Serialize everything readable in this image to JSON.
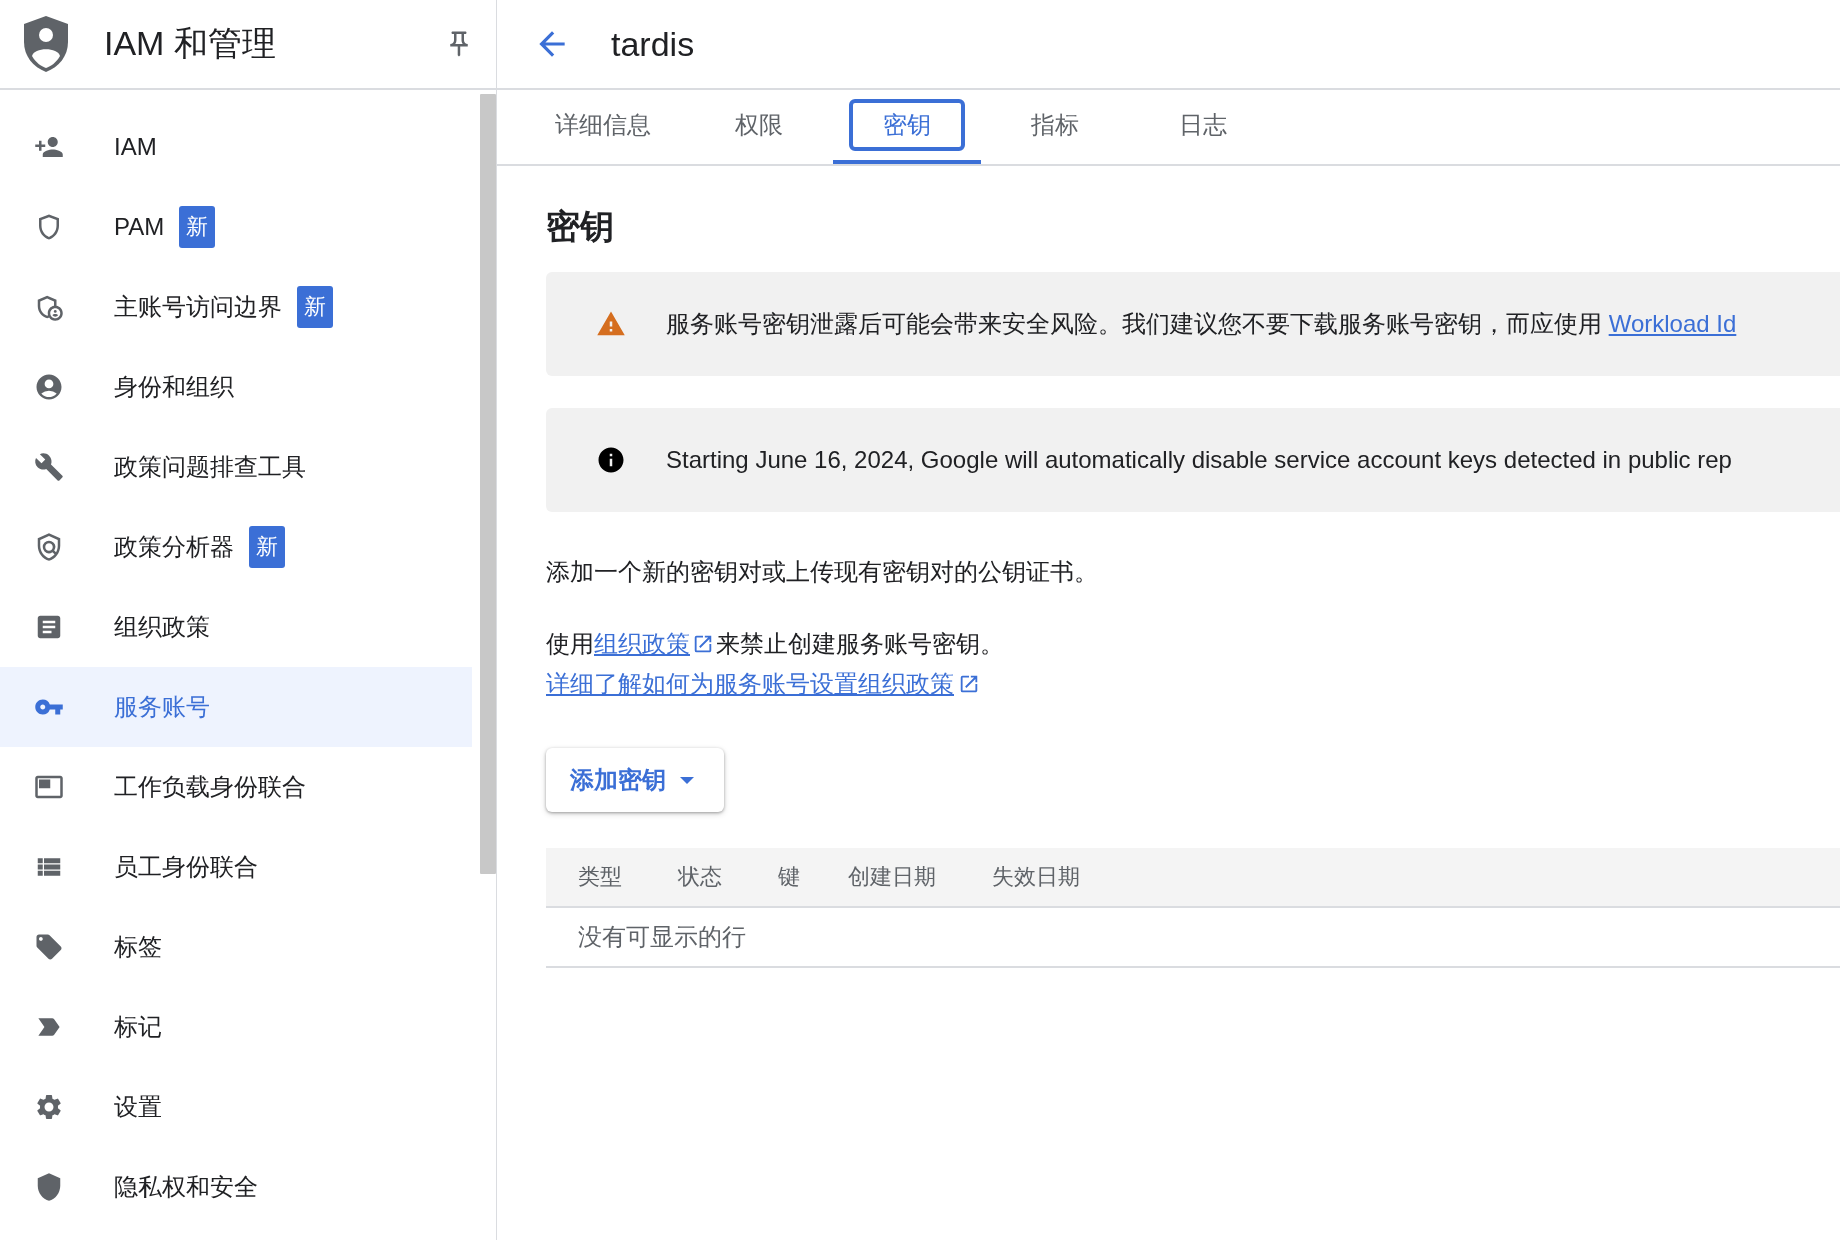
{
  "sidebar": {
    "title": "IAM 和管理",
    "items": [
      {
        "label": "IAM",
        "selected": false
      },
      {
        "label": "PAM",
        "badge": "新",
        "selected": false
      },
      {
        "label": "主账号访问边界",
        "badge": "新",
        "selected": false
      },
      {
        "label": "身份和组织",
        "selected": false
      },
      {
        "label": "政策问题排查工具",
        "selected": false
      },
      {
        "label": "政策分析器",
        "badge": "新",
        "selected": false
      },
      {
        "label": "组织政策",
        "selected": false
      },
      {
        "label": "服务账号",
        "selected": true
      },
      {
        "label": "工作负载身份联合",
        "selected": false
      },
      {
        "label": "员工身份联合",
        "selected": false
      },
      {
        "label": "标签",
        "selected": false
      },
      {
        "label": "标记",
        "selected": false
      },
      {
        "label": "设置",
        "selected": false
      },
      {
        "label": "隐私权和安全",
        "selected": false
      }
    ]
  },
  "header": {
    "title": "tardis"
  },
  "tabs": [
    {
      "label": "详细信息",
      "selected": false
    },
    {
      "label": "权限",
      "selected": false
    },
    {
      "label": "密钥",
      "selected": true
    },
    {
      "label": "指标",
      "selected": false
    },
    {
      "label": "日志",
      "selected": false
    }
  ],
  "section": {
    "heading": "密钥",
    "banners": [
      {
        "kind": "warning",
        "text": "服务账号密钥泄露后可能会带来安全风险。我们建议您不要下载服务账号密钥，而应使用 ",
        "link": "Workload Id"
      },
      {
        "kind": "info",
        "text": "Starting June 16, 2024, Google will automatically disable service account keys detected in public rep"
      }
    ],
    "description": "添加一个新的密钥对或上传现有密钥对的公钥证书。",
    "policy_note": {
      "before": "使用",
      "link": "组织政策",
      "after": "来禁止创建服务账号密钥。"
    },
    "learn_more": "详细了解如何为服务账号设置组织政策",
    "add_button": "添加密钥",
    "table": {
      "columns": [
        "类型",
        "状态",
        "键",
        "创建日期",
        "失效日期"
      ],
      "empty_message": "没有可显示的行"
    }
  }
}
